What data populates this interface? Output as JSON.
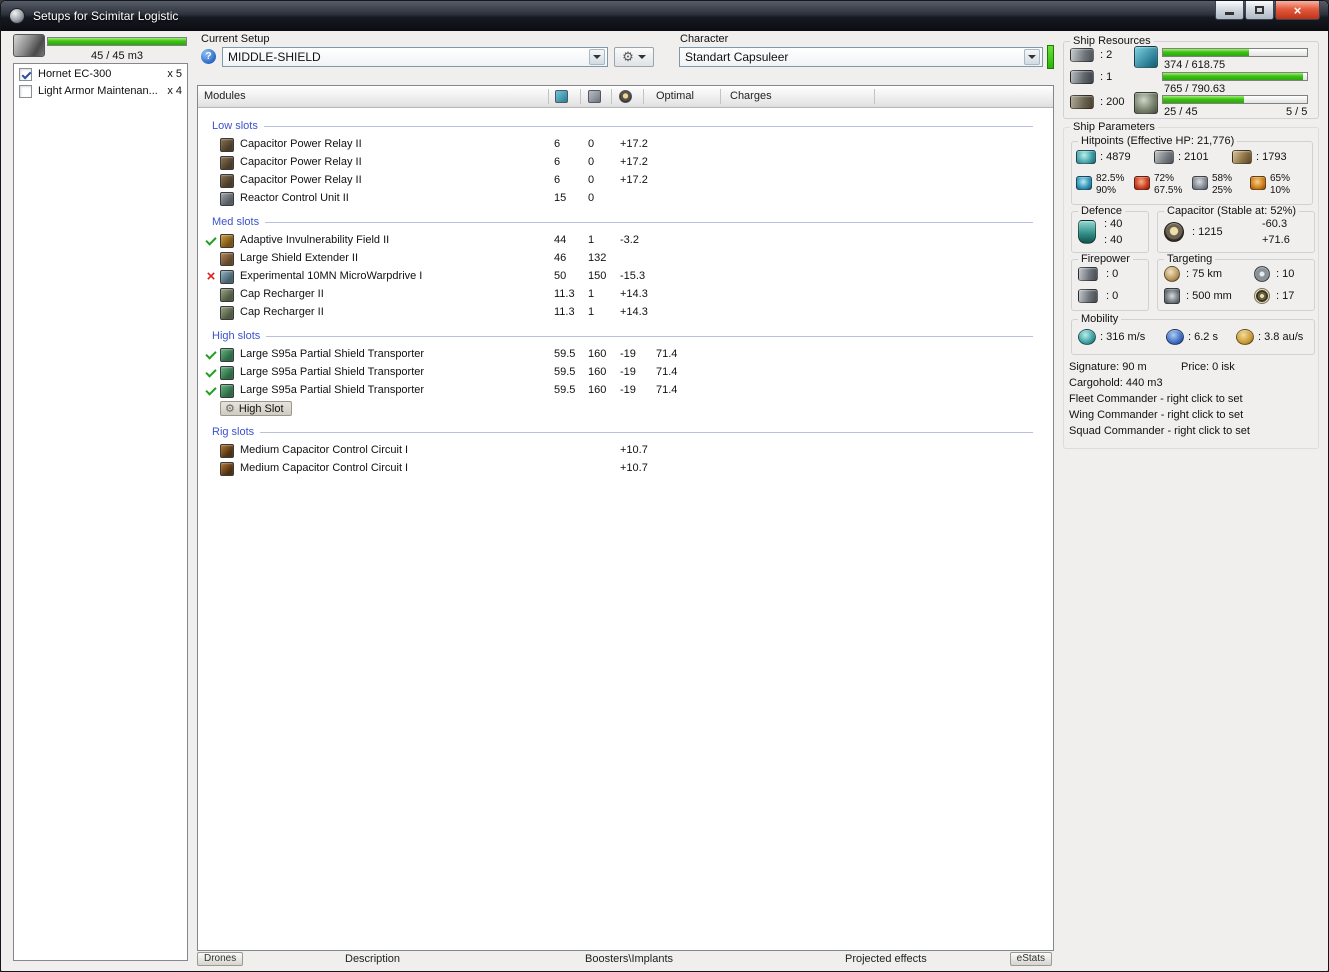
{
  "window": {
    "title": "Setups for Scimitar Logistic"
  },
  "glyphs": {
    "help": "?",
    "wrench": "⚙",
    "close": "×",
    "cross": "×"
  },
  "drone_bay": {
    "capacity_label": "45 / 45 m3",
    "fill_percent": 100,
    "items": [
      {
        "name": "Hornet EC-300",
        "qty": "x 5",
        "checked": true
      },
      {
        "name": "Light Armor Maintenan...",
        "qty": "x 4",
        "checked": false
      }
    ]
  },
  "current_setup": {
    "label": "Current Setup",
    "value": "MIDDLE-SHIELD"
  },
  "character": {
    "label": "Character",
    "value": "Standart Capsuleer"
  },
  "modules_panel": {
    "columns": {
      "name": "Modules",
      "optimal": "Optimal",
      "charges": "Charges"
    },
    "sections": [
      {
        "title": "Low slots",
        "rows": [
          {
            "icon": "cap-relay",
            "name": "Capacitor Power Relay II",
            "cpu": "6",
            "pg": "0",
            "cap": "+17.2"
          },
          {
            "icon": "cap-relay",
            "name": "Capacitor Power Relay II",
            "cpu": "6",
            "pg": "0",
            "cap": "+17.2"
          },
          {
            "icon": "cap-relay",
            "name": "Capacitor Power Relay II",
            "cpu": "6",
            "pg": "0",
            "cap": "+17.2"
          },
          {
            "icon": "reactor",
            "name": "Reactor Control Unit II",
            "cpu": "15",
            "pg": "0"
          }
        ]
      },
      {
        "title": "Med slots",
        "rows": [
          {
            "status": "check",
            "icon": "invul",
            "name": "Adaptive Invulnerability Field II",
            "cpu": "44",
            "pg": "1",
            "cap": "-3.2"
          },
          {
            "icon": "shield-ext",
            "name": "Large Shield Extender II",
            "cpu": "46",
            "pg": "132"
          },
          {
            "status": "cross",
            "icon": "mwd",
            "name": "Experimental 10MN MicroWarpdrive I",
            "cpu": "50",
            "pg": "150",
            "cap": "-15.3"
          },
          {
            "icon": "recharger",
            "name": "Cap Recharger II",
            "cpu": "11.3",
            "pg": "1",
            "cap": "+14.3"
          },
          {
            "icon": "recharger",
            "name": "Cap Recharger II",
            "cpu": "11.3",
            "pg": "1",
            "cap": "+14.3"
          }
        ]
      },
      {
        "title": "High slots",
        "rows": [
          {
            "status": "check",
            "icon": "transporter",
            "name": "Large S95a Partial Shield Transporter",
            "cpu": "59.5",
            "pg": "160",
            "cap": "-19",
            "optimal": "71.4"
          },
          {
            "status": "check",
            "icon": "transporter",
            "name": "Large S95a Partial Shield Transporter",
            "cpu": "59.5",
            "pg": "160",
            "cap": "-19",
            "optimal": "71.4"
          },
          {
            "status": "check",
            "icon": "transporter",
            "name": "Large S95a Partial Shield Transporter",
            "cpu": "59.5",
            "pg": "160",
            "cap": "-19",
            "optimal": "71.4"
          },
          {
            "empty": true,
            "name": "High Slot"
          }
        ]
      },
      {
        "title": "Rig slots",
        "rows": [
          {
            "icon": "rig",
            "name": "Medium Capacitor Control Circuit I",
            "cap": "+10.7"
          },
          {
            "icon": "rig",
            "name": "Medium Capacitor Control Circuit I",
            "cap": "+10.7"
          }
        ]
      }
    ],
    "tabs": [
      {
        "label": "Drones"
      },
      {
        "label": "Description"
      },
      {
        "label": "Boosters\\Implants"
      },
      {
        "label": "Projected effects"
      },
      {
        "label": "eStats"
      }
    ]
  },
  "ship_resources": {
    "title": "Ship Resources",
    "turrets": ": 2",
    "launchers": ": 1",
    "calibration": ": 200",
    "cpu": {
      "text": "374 / 618.75",
      "percent": 60
    },
    "powergrid": {
      "text": "765 / 790.63",
      "percent": 97
    },
    "drone_bandwidth": {
      "text": "25 / 45",
      "percent": 56
    },
    "drones_active": "5 / 5"
  },
  "ship_parameters": {
    "title": "Ship Parameters",
    "hitpoints": {
      "title": "Hitpoints (Effective HP: 21,776)",
      "shield": ": 4879",
      "armor": ": 2101",
      "hull": ": 1793",
      "resists": [
        {
          "type": "em",
          "shield": "82.5%",
          "armor": "90%"
        },
        {
          "type": "thermal",
          "shield": "72%",
          "armor": "67.5%"
        },
        {
          "type": "kinetic",
          "shield": "58%",
          "armor": "25%"
        },
        {
          "type": "explosive",
          "shield": "65%",
          "armor": "10%"
        }
      ]
    },
    "defence": {
      "title": "Defence",
      "value_top": ": 40",
      "value_bottom": ": 40"
    },
    "capacitor": {
      "title": "Capacitor (Stable at: 52%)",
      "amount": ": 1215",
      "usage": "-60.3",
      "recharge": "+71.6"
    },
    "firepower": {
      "title": "Firepower",
      "volley": ": 0",
      "dps": ": 0"
    },
    "targeting": {
      "title": "Targeting",
      "range": ": 75 km",
      "max_targets": ": 10",
      "scan_resolution": ": 500 mm",
      "sensor_strength": ": 17"
    },
    "mobility": {
      "title": "Mobility",
      "speed": ": 316 m/s",
      "align_time": ": 6.2 s",
      "warp_speed": ": 3.8 au/s"
    },
    "info": {
      "signature": "Signature: 90 m",
      "price": "Price: 0 isk",
      "cargohold": "Cargohold: 440 m3",
      "fleet": "Fleet Commander - right click to set",
      "wing": "Wing Commander - right click to set",
      "squad": "Squad Commander - right click to set"
    }
  }
}
